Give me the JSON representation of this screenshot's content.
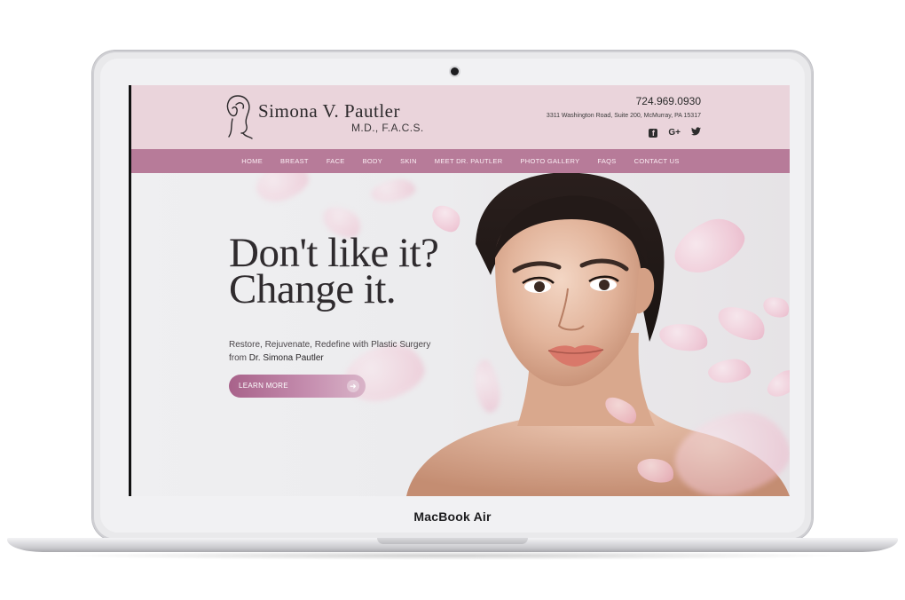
{
  "device": {
    "label": "MacBook Air"
  },
  "site": {
    "logo": {
      "name": "Simona V. Pautler",
      "credentials": "M.D., F.A.C.S."
    },
    "contact": {
      "phone": "724.969.0930",
      "address": "3311 Washington Road, Suite 200, McMurray, PA 15317"
    },
    "socials": [
      {
        "icon": "facebook-icon",
        "glyph": "f"
      },
      {
        "icon": "google-plus-icon",
        "glyph": "G+"
      },
      {
        "icon": "twitter-icon",
        "glyph": "🐦"
      }
    ],
    "nav": [
      "HOME",
      "BREAST",
      "FACE",
      "BODY",
      "SKIN",
      "MEET DR. PAUTLER",
      "PHOTO GALLERY",
      "FAQS",
      "CONTACT US"
    ],
    "hero": {
      "headline_line1": "Don't like it?",
      "headline_line2": "Change it.",
      "sub_line1": "Restore, Rejuvenate, Redefine with Plastic Surgery",
      "sub_line2_prefix": "from ",
      "sub_line2_name": "Dr. Simona Pautler",
      "cta_label": "LEARN MORE",
      "cta_icon": "arrow-right-icon"
    }
  },
  "colors": {
    "header_bg": "#ead4db",
    "nav_bg": "#b77b99",
    "cta_start": "#a8628a",
    "petal": "#f1bfd0"
  }
}
